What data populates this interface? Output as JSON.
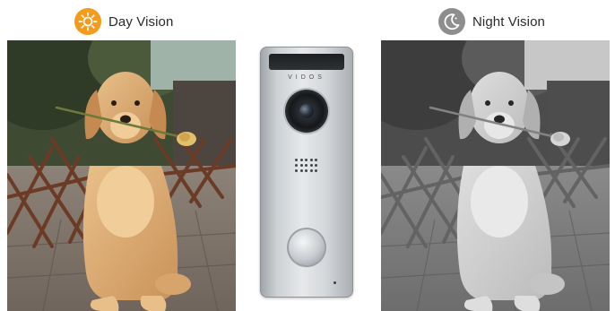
{
  "modes": {
    "day": {
      "label": "Day Vision",
      "icon": "sun-icon",
      "badge_color": "#f39b1d"
    },
    "night": {
      "label": "Night Vision",
      "icon": "moon-icon",
      "badge_color": "#8e8e8e"
    }
  },
  "doorbell": {
    "brand": "VIDOS"
  }
}
